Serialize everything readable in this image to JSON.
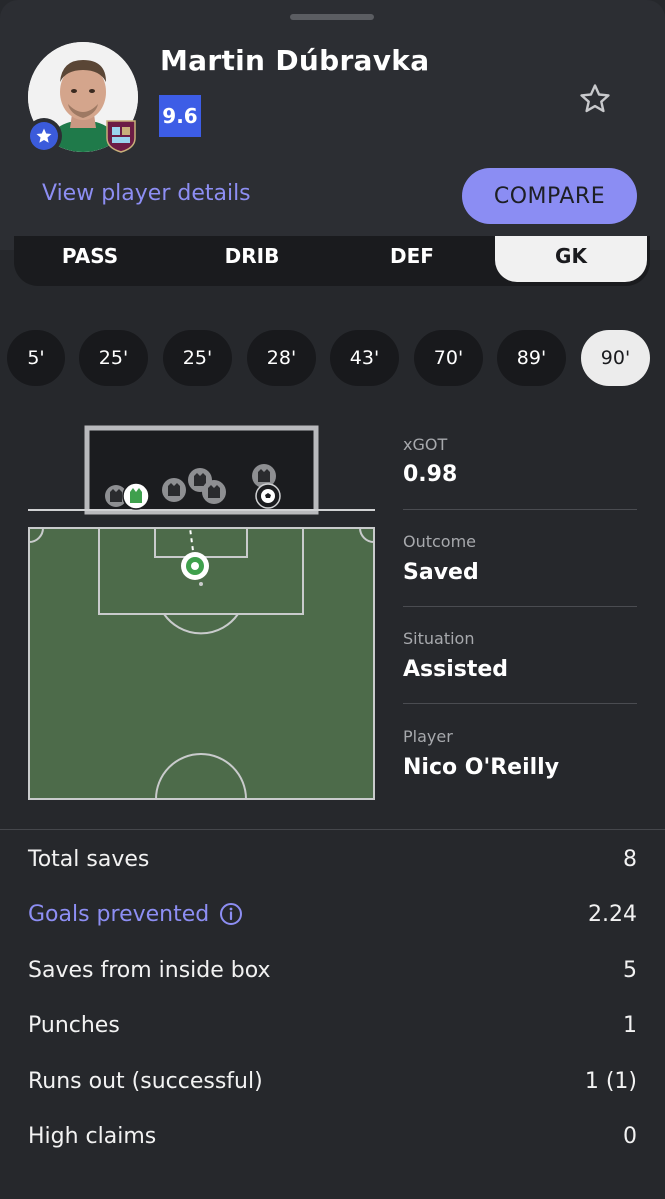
{
  "player": {
    "name": "Martin Dúbravka",
    "rating": "9.6",
    "view_details_label": "View player details",
    "compare_label": "COMPARE"
  },
  "tabs": [
    {
      "label": "PASS",
      "active": false
    },
    {
      "label": "DRIB",
      "active": false
    },
    {
      "label": "DEF",
      "active": false
    },
    {
      "label": "GK",
      "active": true
    }
  ],
  "minutes": [
    "5'",
    "25'",
    "25'",
    "28'",
    "43'",
    "70'",
    "89'",
    "90'"
  ],
  "selected_minute": "90'",
  "shot_info": [
    {
      "label": "xGOT",
      "value": "0.98"
    },
    {
      "label": "Outcome",
      "value": "Saved"
    },
    {
      "label": "Situation",
      "value": "Assisted"
    },
    {
      "label": "Player",
      "value": "Nico O'Reilly"
    }
  ],
  "stats": [
    {
      "label": "Total saves",
      "value": "8",
      "link": false
    },
    {
      "label": "Goals prevented",
      "value": "2.24",
      "link": true
    },
    {
      "label": "Saves from inside box",
      "value": "5",
      "link": false
    },
    {
      "label": "Punches",
      "value": "1",
      "link": false
    },
    {
      "label": "Runs out (successful)",
      "value": "1 (1)",
      "link": false
    },
    {
      "label": "High claims",
      "value": "0",
      "link": false
    }
  ],
  "colors": {
    "accent": "#8b8df3",
    "rating": "#3d5de6",
    "pitch": "#4d6b4a",
    "background": "#26282c"
  }
}
